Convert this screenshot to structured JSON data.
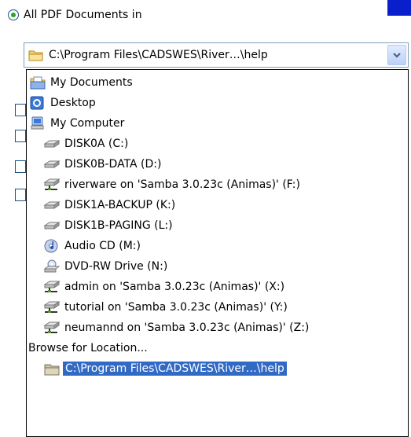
{
  "search": {
    "radio_label": "All PDF Documents in",
    "combo_value": "C:\\Program Files\\CADSWES\\River…\\help"
  },
  "dropdown": {
    "items": [
      {
        "label": "My Documents",
        "icon": "my-documents-icon"
      },
      {
        "label": "Desktop",
        "icon": "desktop-icon"
      },
      {
        "label": "My Computer",
        "icon": "my-computer-icon"
      },
      {
        "label": "DISK0A (C:)",
        "icon": "hard-drive-icon"
      },
      {
        "label": "DISK0B-DATA (D:)",
        "icon": "hard-drive-icon"
      },
      {
        "label": "riverware on 'Samba 3.0.23c (Animas)' (F:)",
        "icon": "network-drive-icon"
      },
      {
        "label": "DISK1A-BACKUP (K:)",
        "icon": "hard-drive-icon"
      },
      {
        "label": "DISK1B-PAGING (L:)",
        "icon": "hard-drive-icon"
      },
      {
        "label": "Audio CD (M:)",
        "icon": "audio-cd-icon"
      },
      {
        "label": "DVD-RW Drive (N:)",
        "icon": "dvd-drive-icon"
      },
      {
        "label": "admin on 'Samba 3.0.23c (Animas)' (X:)",
        "icon": "network-drive-icon"
      },
      {
        "label": "tutorial on 'Samba 3.0.23c (Animas)' (Y:)",
        "icon": "network-drive-icon"
      },
      {
        "label": "neumannd on 'Samba 3.0.23c (Animas)' (Z:)",
        "icon": "network-drive-icon"
      },
      {
        "label": "Browse for Location..."
      },
      {
        "label": "C:\\Program Files\\CADSWES\\River…\\help",
        "icon": "folder-icon"
      }
    ]
  },
  "colors": {
    "selection": "#316ac5",
    "combo_border": "#7f9db9",
    "radio_dot": "#2aa52a"
  }
}
